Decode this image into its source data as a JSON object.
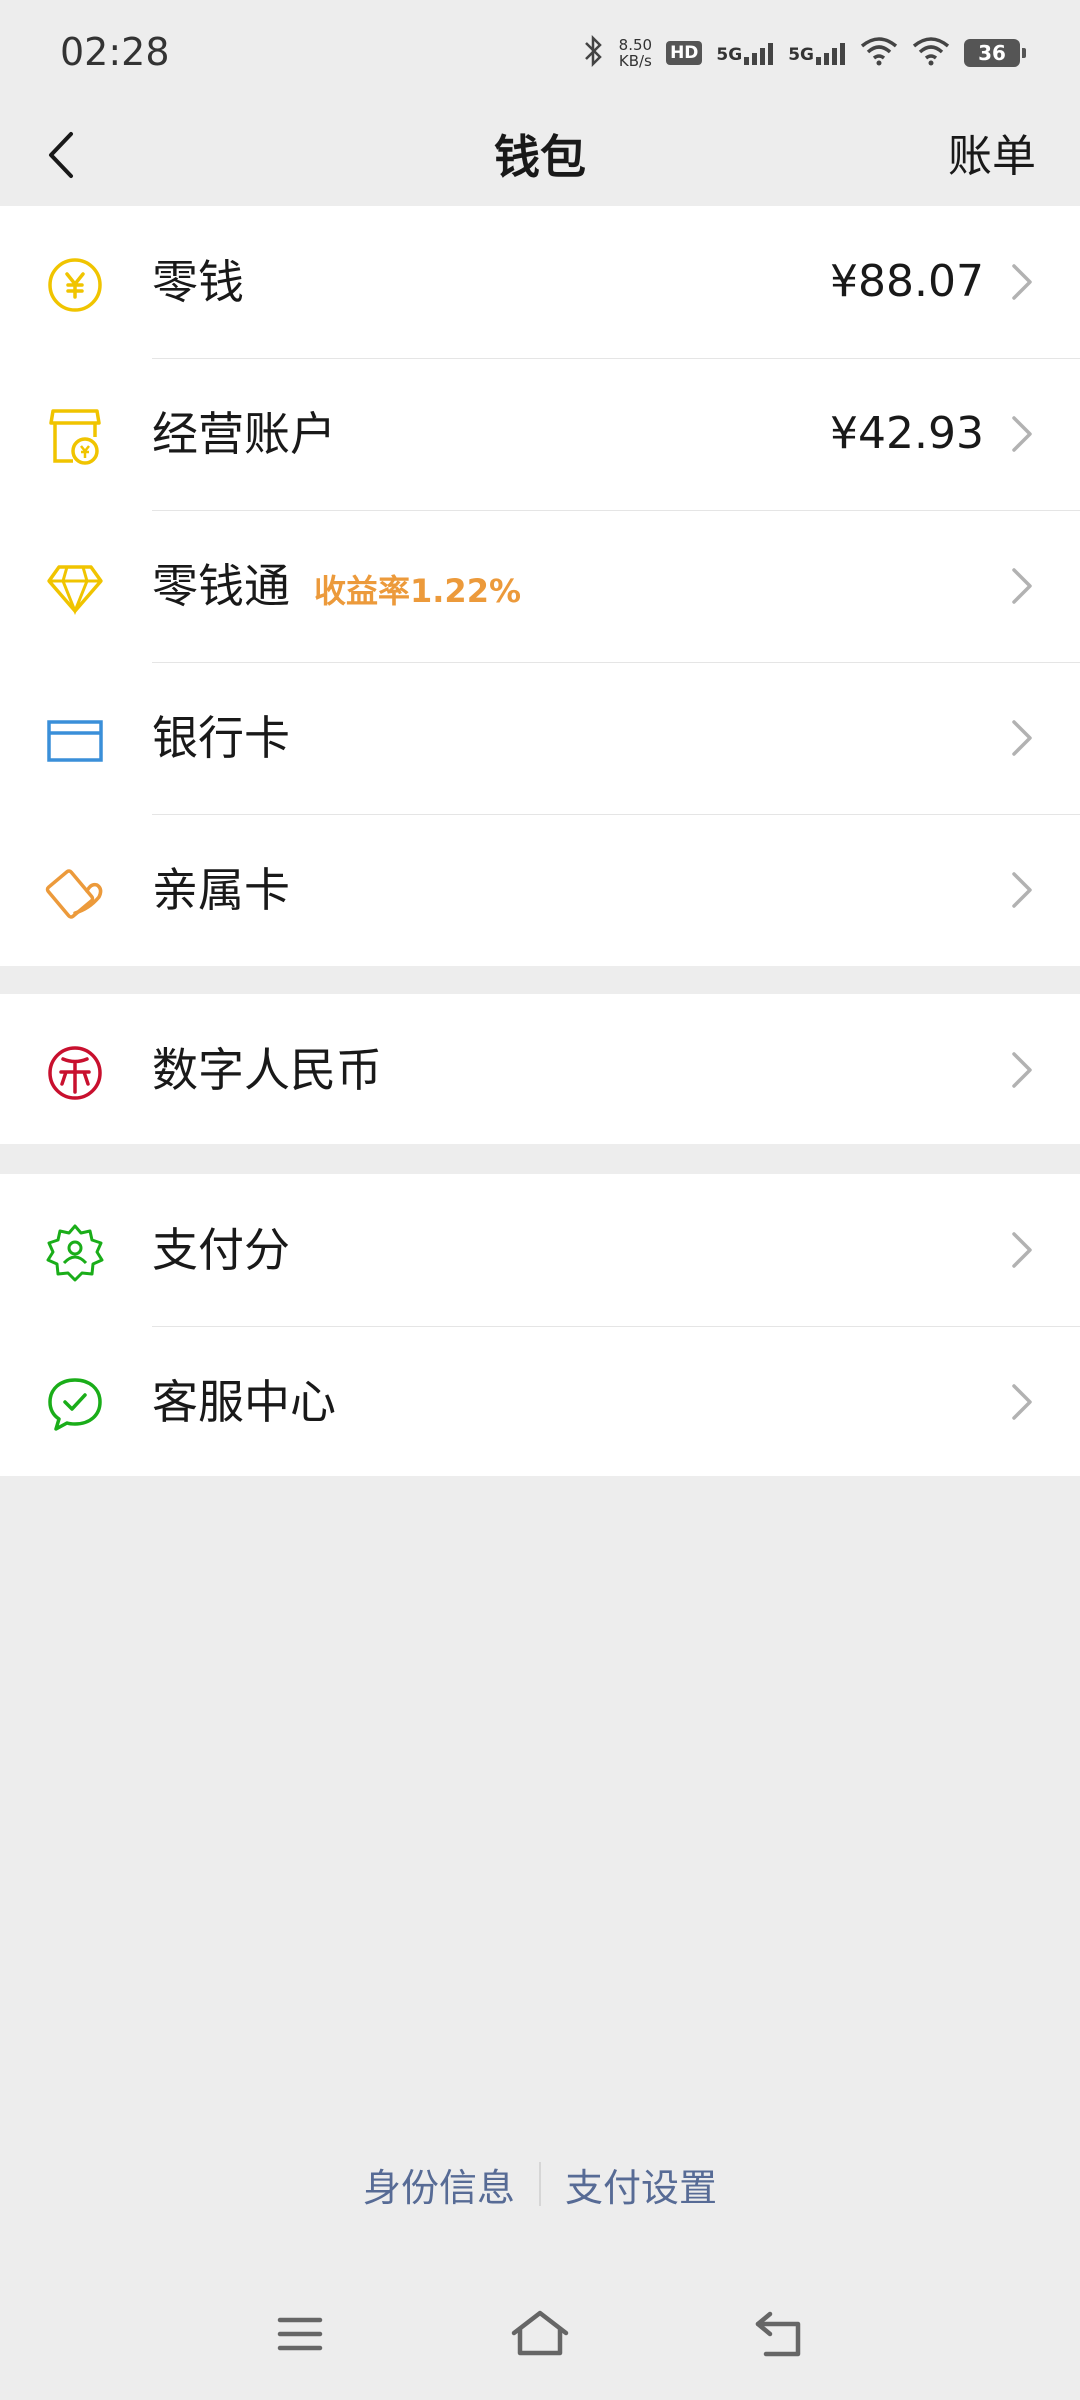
{
  "status_bar": {
    "time": "02:28",
    "net_speed_value": "8.50",
    "net_speed_unit": "KB/s",
    "hd_label": "HD",
    "signal1_label": "5G",
    "signal2_label": "5G",
    "battery": "36"
  },
  "nav": {
    "title": "钱包",
    "right_label": "账单"
  },
  "menu_group1": [
    {
      "label": "零钱",
      "value": "¥88.07",
      "icon": "coin-yuan-icon",
      "color": "#f0c400"
    },
    {
      "label": "经营账户",
      "value": "¥42.93",
      "icon": "shop-icon",
      "color": "#f0c400"
    },
    {
      "label": "零钱通",
      "badge": "收益率1.22%",
      "icon": "diamond-icon",
      "color": "#f0c400"
    },
    {
      "label": "银行卡",
      "icon": "bank-card-icon",
      "color": "#3a8fd9"
    },
    {
      "label": "亲属卡",
      "icon": "family-card-icon",
      "color": "#ec9a3b"
    }
  ],
  "menu_group2": [
    {
      "label": "数字人民币",
      "icon": "digital-rmb-icon",
      "color": "#c8102e"
    }
  ],
  "menu_group3": [
    {
      "label": "支付分",
      "icon": "pay-score-icon",
      "color": "#1aad19"
    },
    {
      "label": "客服中心",
      "icon": "customer-service-icon",
      "color": "#1aad19"
    }
  ],
  "footer": {
    "link1": "身份信息",
    "link2": "支付设置"
  },
  "colors": {
    "link_blue": "#576b95",
    "badge_orange": "#ec9a3b",
    "background": "#ededed"
  }
}
